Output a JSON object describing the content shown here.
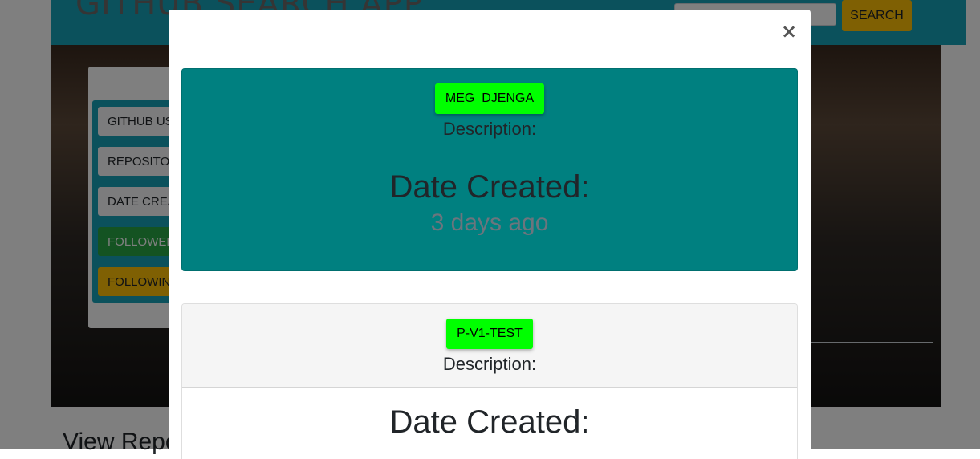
{
  "app": {
    "title": "GITHUB SEARCH APP",
    "search_button": "SEARCH",
    "search_placeholder": ""
  },
  "sidebar": {
    "items": [
      {
        "label": "GITHUB USERNAME"
      },
      {
        "label": "REPOSITORIES"
      },
      {
        "label": "DATE CREATED"
      },
      {
        "label": "FOLLOWERS"
      },
      {
        "label": "FOLLOWING"
      }
    ]
  },
  "section": {
    "heading": "View Repositories"
  },
  "modal": {
    "close_label": "×",
    "repos": [
      {
        "name": "MEG_DJENGA",
        "description_label": "Description:",
        "date_label": "Date Created:",
        "date_value": "3 days ago"
      },
      {
        "name": "P-V1-TEST",
        "description_label": "Description:",
        "date_label": "Date Created:",
        "date_value": ""
      }
    ]
  },
  "colors": {
    "navbar": "#17a2b8",
    "search_button": "#ffc107",
    "repo_button": "#00ff00",
    "card_teal": "#008080",
    "success": "#28a745",
    "warning": "#ffc107"
  }
}
